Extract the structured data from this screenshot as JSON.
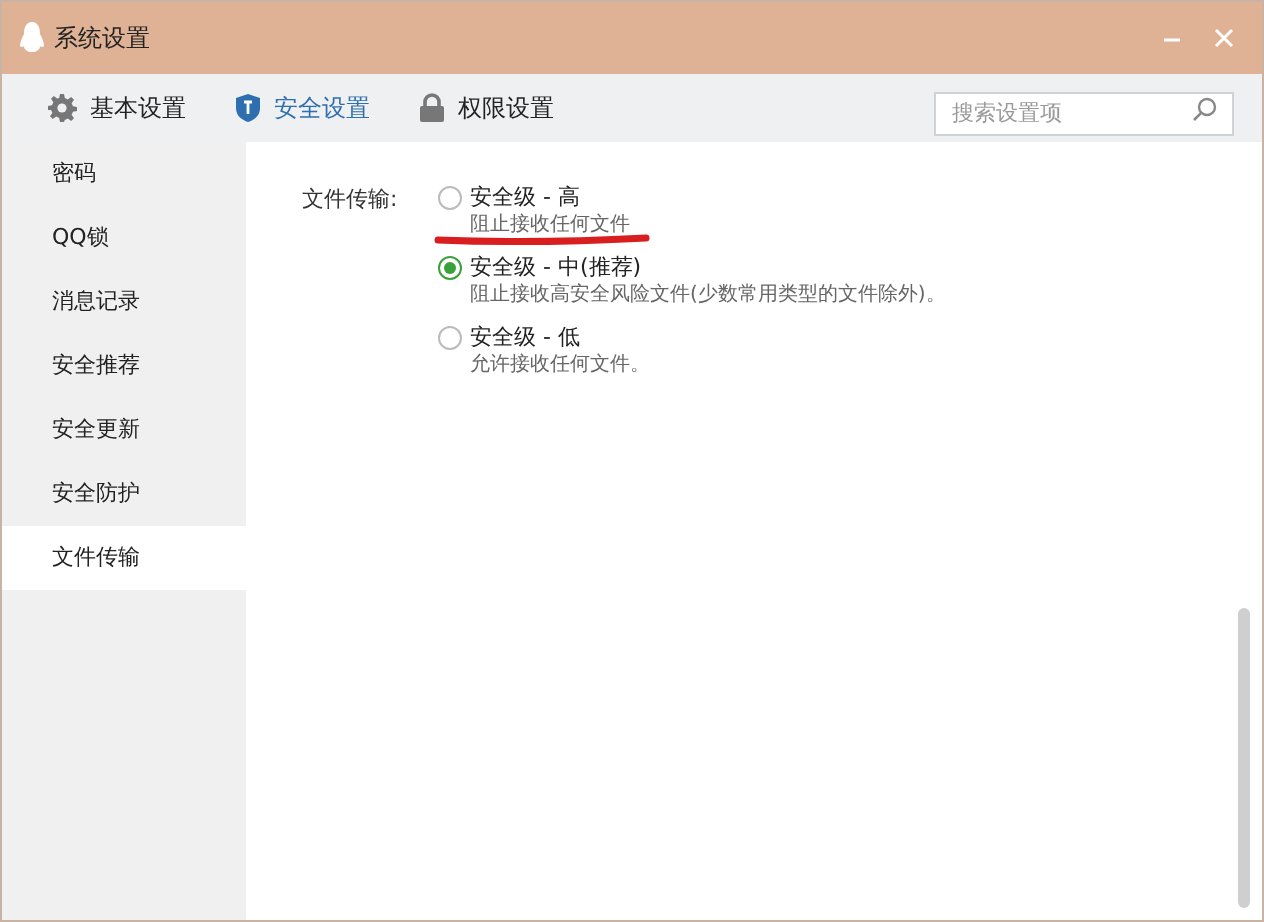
{
  "window": {
    "title": "系统设置"
  },
  "tabs": [
    {
      "label": "基本设置",
      "kind": "gear",
      "selected": false
    },
    {
      "label": "安全设置",
      "kind": "shield",
      "selected": true
    },
    {
      "label": "权限设置",
      "kind": "lock",
      "selected": false
    }
  ],
  "search": {
    "placeholder": "搜索设置项"
  },
  "sidebar": {
    "items": [
      {
        "label": "密码",
        "selected": false
      },
      {
        "label": "QQ锁",
        "selected": false
      },
      {
        "label": "消息记录",
        "selected": false
      },
      {
        "label": "安全推荐",
        "selected": false
      },
      {
        "label": "安全更新",
        "selected": false
      },
      {
        "label": "安全防护",
        "selected": false
      },
      {
        "label": "文件传输",
        "selected": true
      }
    ]
  },
  "file_transfer": {
    "label": "文件传输:",
    "options": [
      {
        "title": "安全级 - 高",
        "description": "阻止接收任何文件",
        "selected": false
      },
      {
        "title": "安全级 - 中(推荐)",
        "description": "阻止接收高安全风险文件(少数常用类型的文件除外)。",
        "selected": true
      },
      {
        "title": "安全级 - 低",
        "description": "允许接收任何文件。",
        "selected": false
      }
    ]
  }
}
